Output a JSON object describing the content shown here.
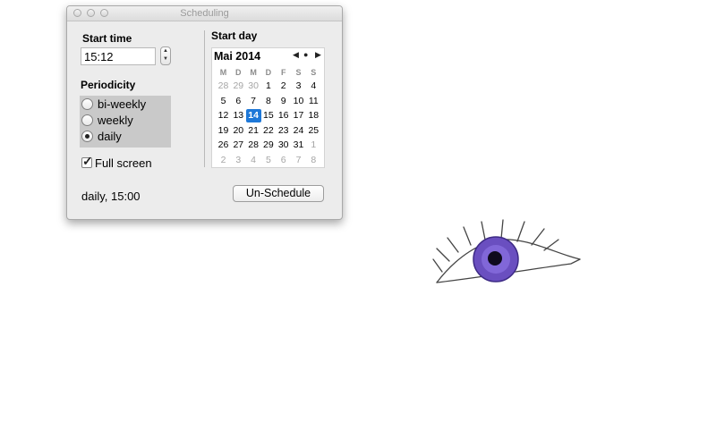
{
  "window": {
    "title": "Scheduling"
  },
  "start_time": {
    "label": "Start time",
    "value": "15:12",
    "stepper_up": "▲",
    "stepper_down": "▼"
  },
  "periodicity": {
    "label": "Periodicity",
    "options": [
      {
        "label": "bi-weekly",
        "selected": false
      },
      {
        "label": "weekly",
        "selected": false
      },
      {
        "label": "daily",
        "selected": true
      }
    ]
  },
  "full_screen": {
    "label": "Full screen",
    "checked": true,
    "check_glyph": "✓"
  },
  "status_text": "daily, 15:00",
  "start_day": {
    "label": "Start day",
    "month_label": "Mai 2014",
    "nav_prev": "◀",
    "nav_today": "●",
    "nav_next": "▶",
    "weekdays": [
      "M",
      "D",
      "M",
      "D",
      "F",
      "S",
      "S"
    ],
    "weeks": [
      [
        {
          "d": "28",
          "o": true
        },
        {
          "d": "29",
          "o": true
        },
        {
          "d": "30",
          "o": true
        },
        {
          "d": "1"
        },
        {
          "d": "2"
        },
        {
          "d": "3"
        },
        {
          "d": "4"
        }
      ],
      [
        {
          "d": "5"
        },
        {
          "d": "6"
        },
        {
          "d": "7"
        },
        {
          "d": "8"
        },
        {
          "d": "9"
        },
        {
          "d": "10"
        },
        {
          "d": "11"
        }
      ],
      [
        {
          "d": "12"
        },
        {
          "d": "13"
        },
        {
          "d": "14",
          "t": true
        },
        {
          "d": "15"
        },
        {
          "d": "16"
        },
        {
          "d": "17"
        },
        {
          "d": "18"
        }
      ],
      [
        {
          "d": "19"
        },
        {
          "d": "20"
        },
        {
          "d": "21"
        },
        {
          "d": "22"
        },
        {
          "d": "23"
        },
        {
          "d": "24"
        },
        {
          "d": "25"
        }
      ],
      [
        {
          "d": "26"
        },
        {
          "d": "27"
        },
        {
          "d": "28"
        },
        {
          "d": "29"
        },
        {
          "d": "30"
        },
        {
          "d": "31"
        },
        {
          "d": "1",
          "o": true
        }
      ],
      [
        {
          "d": "2",
          "o": true
        },
        {
          "d": "3",
          "o": true
        },
        {
          "d": "4",
          "o": true
        },
        {
          "d": "5",
          "o": true
        },
        {
          "d": "6",
          "o": true
        },
        {
          "d": "7",
          "o": true
        },
        {
          "d": "8",
          "o": true
        }
      ]
    ]
  },
  "unschedule_button": "Un-Schedule",
  "colors": {
    "selected_day": "#1e78d8",
    "iris": "#6a4fc0"
  }
}
